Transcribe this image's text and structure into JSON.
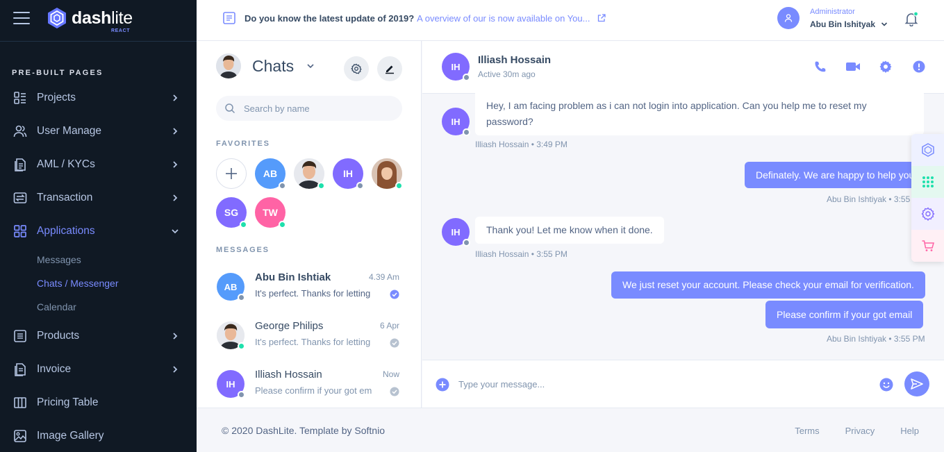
{
  "brand": {
    "name_bold": "dash",
    "name_light": "lite",
    "sub": "REACT",
    "accent": "#798bff"
  },
  "sidebar": {
    "section_title": "PRE-BUILT PAGES",
    "items": [
      {
        "label": "Projects",
        "icon": "projects-icon"
      },
      {
        "label": "User Manage",
        "icon": "users-icon"
      },
      {
        "label": "AML / KYCs",
        "icon": "file-docs-icon"
      },
      {
        "label": "Transaction",
        "icon": "exchange-icon"
      },
      {
        "label": "Applications",
        "icon": "grid-icon"
      },
      {
        "label": "Products",
        "icon": "list-box-icon"
      },
      {
        "label": "Invoice",
        "icon": "file-docs-icon"
      },
      {
        "label": "Pricing Table",
        "icon": "columns-icon"
      },
      {
        "label": "Image Gallery",
        "icon": "image-icon"
      }
    ],
    "sub_items": [
      "Messages",
      "Chats / Messenger",
      "Calendar"
    ]
  },
  "topbar": {
    "news_bold": "Do you know the latest update of 2019?",
    "news_light": "A overview of our is now available on You...",
    "user_role": "Administrator",
    "user_name": "Abu Bin Ishityak"
  },
  "chatlist": {
    "title": "Chats",
    "search_placeholder": "Search by name",
    "favorites_title": "FAVORITES",
    "messages_title": "MESSAGES",
    "favorites": [
      {
        "initials": "AB",
        "bg": "#559bfb",
        "status": "offline"
      },
      {
        "initials": "",
        "bg": "photo",
        "status": "online"
      },
      {
        "initials": "IH",
        "bg": "#816bff",
        "status": "offline"
      },
      {
        "initials": "",
        "bg": "photo-f",
        "status": "online"
      },
      {
        "initials": "SG",
        "bg": "#816bff",
        "status": "online"
      },
      {
        "initials": "TW",
        "bg": "#ff63a5",
        "status": "online"
      }
    ],
    "messages": [
      {
        "initials": "AB",
        "bg": "#559bfb",
        "name": "Abu Bin Ishtiak",
        "time": "4.39 Am",
        "preview": "It's perfect. Thanks for letting",
        "read": "blue"
      },
      {
        "initials": "",
        "bg": "photo",
        "name": "George Philips",
        "time": "6 Apr",
        "preview": "It's perfect. Thanks for letting",
        "read": "grey"
      },
      {
        "initials": "IH",
        "bg": "#816bff",
        "name": "Illiash Hossain",
        "time": "Now",
        "preview": "Please confirm if your got em",
        "read": "grey"
      }
    ]
  },
  "conversation": {
    "initials": "IH",
    "name": "Illiash Hossain",
    "status": "Active  30m ago",
    "messages": [
      {
        "dir": "in",
        "text": "Hey, I am facing problem as i can not login into application. Can you help me to reset my password?",
        "meta": "Illiash Hossain • 3:49 PM"
      },
      {
        "dir": "out",
        "text": "Definately. We are happy to help you.",
        "meta": "Abu Bin Ishtiyak • 3:55 PM"
      },
      {
        "dir": "in",
        "text": "Thank you! Let me know when it done.",
        "meta": "Illiash Hossain • 3:55 PM"
      },
      {
        "dir": "out",
        "text": "We just reset your account. Please check your email for verification.",
        "meta": ""
      },
      {
        "dir": "out",
        "text": "Please confirm if your got email",
        "meta": "Abu Bin Ishtiyak • 3:55 PM"
      }
    ],
    "input_placeholder": "Type your message..."
  },
  "footer": {
    "copy": "© 2020 DashLite. Template by Softnio",
    "links": [
      "Terms",
      "Privacy",
      "Help"
    ]
  }
}
